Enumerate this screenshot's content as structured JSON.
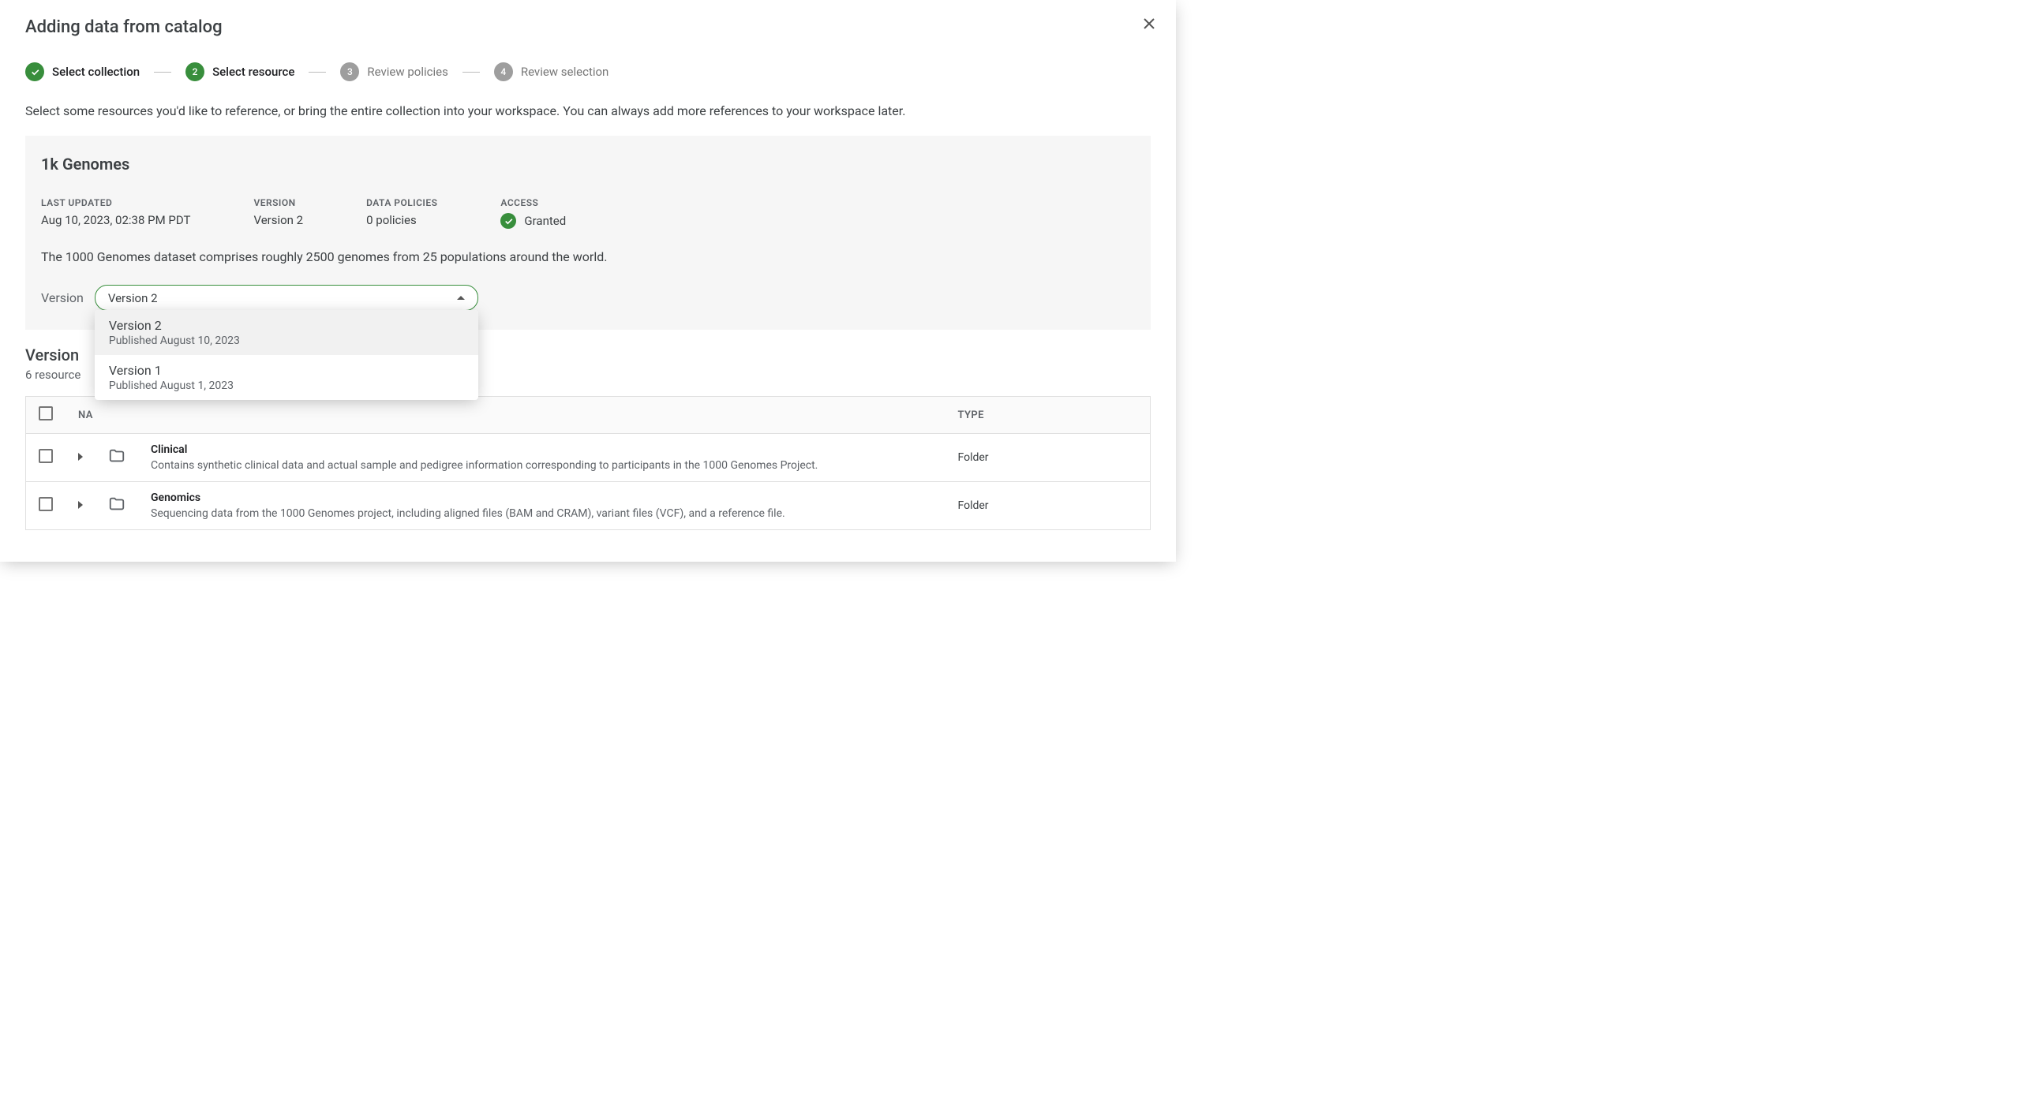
{
  "title": "Adding data from catalog",
  "steps": [
    {
      "label": "Select collection",
      "state": "done"
    },
    {
      "label": "Select resource",
      "state": "active",
      "num": "2"
    },
    {
      "label": "Review policies",
      "state": "pending",
      "num": "3"
    },
    {
      "label": "Review selection",
      "state": "pending",
      "num": "4"
    }
  ],
  "instructions": "Select some resources you'd like to reference, or bring the entire collection into your workspace. You can always add more references to your workspace later.",
  "collection": {
    "name": "1k Genomes",
    "last_updated_label": "LAST UPDATED",
    "last_updated": "Aug 10, 2023, 02:38 PM PDT",
    "version_label": "VERSION",
    "version": "Version 2",
    "policies_label": "DATA POLICIES",
    "policies": "0 policies",
    "access_label": "ACCESS",
    "access": "Granted",
    "description": "The 1000 Genomes dataset comprises roughly 2500 genomes from 25 populations around the world."
  },
  "version_picker": {
    "label": "Version",
    "selected": "Version 2",
    "options": [
      {
        "title": "Version 2",
        "sub": "Published August 10, 2023",
        "selected": true
      },
      {
        "title": "Version 1",
        "sub": "Published August 1, 2023",
        "selected": false
      }
    ]
  },
  "section": {
    "title": "Version",
    "sub": "6 resource"
  },
  "table": {
    "col_name": "NA",
    "col_type": "TYPE",
    "rows": [
      {
        "name": "Clinical",
        "desc": "Contains synthetic clinical data and actual sample and pedigree information corresponding to participants in the 1000 Genomes Project.",
        "type": "Folder"
      },
      {
        "name": "Genomics",
        "desc": "Sequencing data from the 1000 Genomes project, including aligned files (BAM and CRAM), variant files (VCF), and a reference file.",
        "type": "Folder"
      }
    ]
  }
}
